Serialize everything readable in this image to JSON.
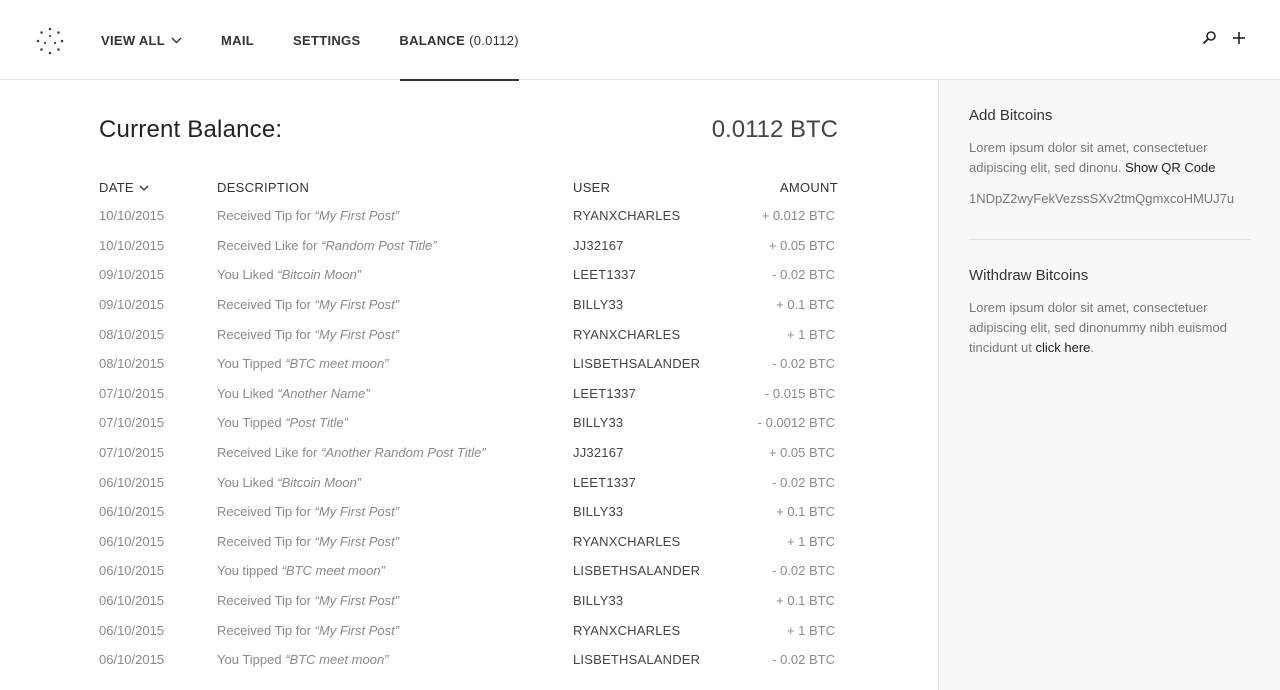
{
  "nav": {
    "items": [
      {
        "label": "VIEW ALL"
      },
      {
        "label": "MAIL"
      },
      {
        "label": "SETTINGS"
      },
      {
        "label": "BALANCE",
        "value": "(0.0112)"
      }
    ]
  },
  "icons": {
    "logo": "dotted-circle-logo",
    "search": "search-icon",
    "add": "plus-icon",
    "dropdown": "chevron-down-icon"
  },
  "balance": {
    "title": "Current Balance:",
    "value": "0.0112 BTC"
  },
  "table": {
    "headers": {
      "date": "DATE",
      "description": "DESCRIPTION",
      "user": "USER",
      "amount": "AMOUNT"
    },
    "rows": [
      {
        "date": "10/10/2015",
        "desc_prefix": "Received Tip for ",
        "desc_title": "“My First Post”",
        "user": "RYANXCHARLES",
        "amount": "+ 0.012 BTC"
      },
      {
        "date": "10/10/2015",
        "desc_prefix": "Received Like for ",
        "desc_title": "“Random Post Title”",
        "user": "JJ32167",
        "amount": "+ 0.05 BTC"
      },
      {
        "date": "09/10/2015",
        "desc_prefix": "You Liked ",
        "desc_title": "“Bitcoin Moon”",
        "user": "LEET1337",
        "amount": "- 0.02 BTC"
      },
      {
        "date": "09/10/2015",
        "desc_prefix": "Received Tip for ",
        "desc_title": "“My First Post”",
        "user": "BILLY33",
        "amount": "+ 0.1 BTC"
      },
      {
        "date": "08/10/2015",
        "desc_prefix": "Received Tip for ",
        "desc_title": "“My First Post”",
        "user": "RYANXCHARLES",
        "amount": "+ 1 BTC"
      },
      {
        "date": "08/10/2015",
        "desc_prefix": "You Tipped ",
        "desc_title": "“BTC meet moon”",
        "user": "LISBETHSALANDER",
        "amount": "- 0.02 BTC"
      },
      {
        "date": "07/10/2015",
        "desc_prefix": "You Liked  ",
        "desc_title": "“Another Name”",
        "user": "LEET1337",
        "amount": "- 0.015 BTC"
      },
      {
        "date": "07/10/2015",
        "desc_prefix": "You Tipped ",
        "desc_title": "“Post Title”",
        "user": "BILLY33",
        "amount": "- 0.0012 BTC"
      },
      {
        "date": "07/10/2015",
        "desc_prefix": "Received Like for ",
        "desc_title": "“Another Random Post Title”",
        "user": "JJ32167",
        "amount": "+ 0.05 BTC"
      },
      {
        "date": "06/10/2015",
        "desc_prefix": "You Liked ",
        "desc_title": "“Bitcoin Moon”",
        "user": "LEET1337",
        "amount": "- 0.02 BTC"
      },
      {
        "date": "06/10/2015",
        "desc_prefix": "Received Tip for ",
        "desc_title": "“My First Post”",
        "user": "BILLY33",
        "amount": "+ 0.1 BTC"
      },
      {
        "date": "06/10/2015",
        "desc_prefix": "Received Tip for ",
        "desc_title": "“My First Post”",
        "user": "RYANXCHARLES",
        "amount": "+ 1 BTC"
      },
      {
        "date": "06/10/2015",
        "desc_prefix": "You tipped ",
        "desc_title": "“BTC meet moon”",
        "user": "LISBETHSALANDER",
        "amount": "- 0.02 BTC"
      },
      {
        "date": "06/10/2015",
        "desc_prefix": "Received Tip for ",
        "desc_title": "“My First Post”",
        "user": "BILLY33",
        "amount": "+ 0.1 BTC"
      },
      {
        "date": "06/10/2015",
        "desc_prefix": "Received Tip for ",
        "desc_title": "“My First Post”",
        "user": "RYANXCHARLES",
        "amount": "+ 1 BTC"
      },
      {
        "date": "06/10/2015",
        "desc_prefix": "You Tipped ",
        "desc_title": "“BTC meet moon”",
        "user": "LISBETHSALANDER",
        "amount": "- 0.02 BTC"
      }
    ]
  },
  "sidebar": {
    "add": {
      "title": "Add Bitcoins",
      "text": "Lorem ipsum dolor sit amet, consectetuer adipiscing elit, sed dinonu. ",
      "link": "Show QR Code",
      "address": "1NDpZ2wyFekVezssSXv2tmQgmxcoHMUJ7u"
    },
    "withdraw": {
      "title": "Withdraw Bitcoins",
      "text": "Lorem ipsum dolor sit amet, consectetuer adipiscing elit, sed dinonummy nibh euismod tincidunt ut ",
      "link": "click here",
      "suffix": "."
    }
  },
  "colors": {
    "text_dark": "#333333",
    "text_muted": "#8a8a8a",
    "sidebar_bg": "#f8f8f8",
    "border": "#e6e6e6"
  }
}
